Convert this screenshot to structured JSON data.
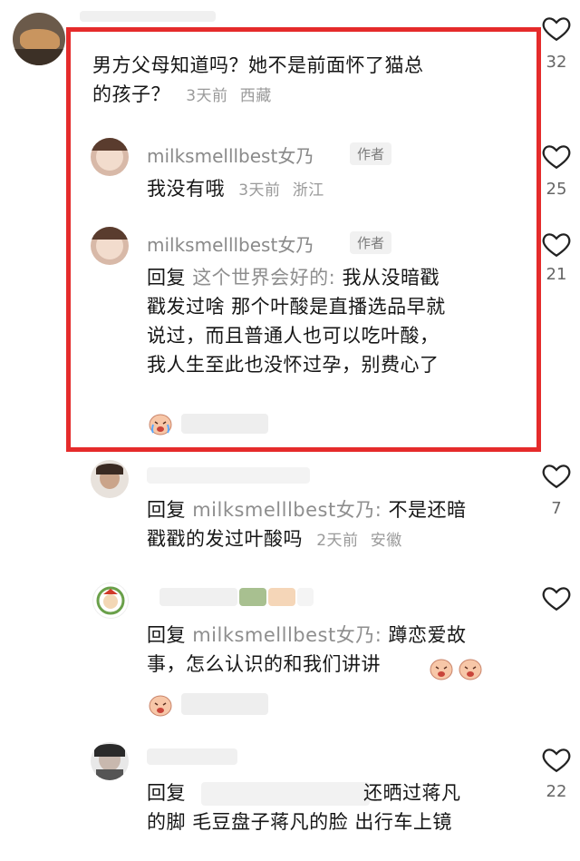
{
  "colors": {
    "highlight": "#e52b2b",
    "reply_name": "#8e8e8e",
    "meta": "#9a9a9a"
  },
  "comments": [
    {
      "text_line1": "男方父母知道吗？她不是前面怀了猫总",
      "text_line2": "的孩子？",
      "time": "3天前",
      "location": "西藏",
      "like_count": "32"
    }
  ],
  "replies": [
    {
      "name": "milksmelllbest女乃",
      "tag": "作者",
      "text": "我没有哦",
      "time": "3天前",
      "location": "浙江",
      "like_count": "25"
    },
    {
      "name": "milksmelllbest女乃",
      "tag": "作者",
      "prefix": "回复",
      "reply_to": "这个世界会好的:",
      "line1": "我从没暗戳",
      "line2": "戳发过啥 那个叶酸是直播选品早就",
      "line3": "说过，而且普通人也可以吃叶酸，",
      "line4": "我人生至此也没怀过孕，别费心了",
      "like_count": "21"
    },
    {
      "prefix": "回复",
      "reply_to": "milksmelllbest女乃:",
      "line1": "不是还暗",
      "line2": "戳戳的发过叶酸吗",
      "time": "2天前",
      "location": "安徽",
      "like_count": "7"
    },
    {
      "prefix": "回复",
      "reply_to": "milksmelllbest女乃:",
      "line1": "蹲恋爱故",
      "line2": "事，怎么认识的和我们讲讲"
    },
    {
      "prefix": "回复",
      "line1": "还晒过蒋凡",
      "line2": "的脚 毛豆盘子蒋凡的脸 出行车上镜",
      "like_count": "22"
    }
  ],
  "icons": [
    "heart-outline-icon",
    "crying-laugh-emoji"
  ]
}
